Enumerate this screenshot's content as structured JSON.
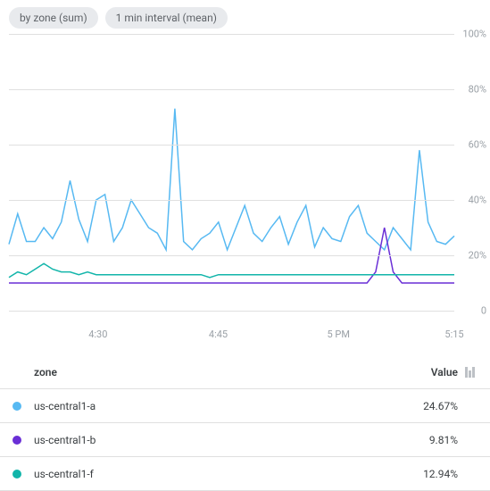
{
  "chips": [
    "by zone (sum)",
    "1 min interval (mean)"
  ],
  "chart_data": {
    "type": "line",
    "ylabel": "%",
    "ylim": [
      0,
      100
    ],
    "xlabel": "",
    "yticks": [
      0,
      20,
      40,
      60,
      80,
      100
    ],
    "ytick_labels": [
      "0",
      "20%",
      "40%",
      "60%",
      "80%",
      "100%"
    ],
    "xticks": [
      "4:30",
      "4:45",
      "5 PM",
      "5:15"
    ],
    "xtick_positions_pct": [
      20,
      47,
      74,
      100
    ],
    "series": [
      {
        "name": "us-central1-a",
        "color": "#57b9f2",
        "values": [
          24,
          35,
          25,
          25,
          30,
          26,
          32,
          47,
          33,
          25,
          40,
          42,
          25,
          30,
          40,
          35,
          30,
          28,
          22,
          73,
          25,
          22,
          26,
          28,
          32,
          22,
          30,
          38,
          28,
          25,
          30,
          34,
          24,
          32,
          38,
          23,
          30,
          26,
          25,
          34,
          38,
          28,
          25,
          22,
          30,
          26,
          22,
          58,
          32,
          25,
          24,
          27
        ]
      },
      {
        "name": "us-central1-b",
        "color": "#6a2fd6",
        "values": [
          10,
          10,
          10,
          10,
          10,
          10,
          10,
          10,
          10,
          10,
          10,
          10,
          10,
          10,
          10,
          10,
          10,
          10,
          10,
          10,
          10,
          10,
          10,
          10,
          10,
          10,
          10,
          10,
          10,
          10,
          10,
          10,
          10,
          10,
          10,
          10,
          10,
          10,
          10,
          10,
          10,
          10,
          14,
          30,
          14,
          10,
          10,
          10,
          10,
          10,
          10,
          10
        ]
      },
      {
        "name": "us-central1-f",
        "color": "#12b5aa",
        "values": [
          12,
          14,
          13,
          15,
          17,
          15,
          14,
          14,
          13,
          14,
          13,
          13,
          13,
          13,
          13,
          13,
          13,
          13,
          13,
          13,
          13,
          13,
          13,
          12,
          13,
          13,
          13,
          13,
          13,
          13,
          13,
          13,
          13,
          13,
          13,
          13,
          13,
          13,
          13,
          13,
          13,
          13,
          13,
          13,
          13,
          13,
          13,
          13,
          13,
          13,
          13,
          13
        ]
      }
    ]
  },
  "table": {
    "header_zone": "zone",
    "header_value": "Value",
    "rows": [
      {
        "color": "#57b9f2",
        "zone": "us-central1-a",
        "value": "24.67%"
      },
      {
        "color": "#6a2fd6",
        "zone": "us-central1-b",
        "value": "9.81%"
      },
      {
        "color": "#12b5aa",
        "zone": "us-central1-f",
        "value": "12.94%"
      }
    ]
  }
}
